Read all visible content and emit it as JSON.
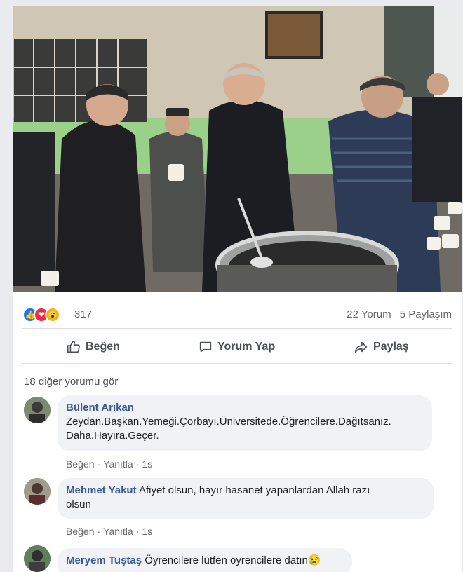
{
  "post": {
    "photo_alt_icon": "photo",
    "reactions": {
      "icons": [
        "like-icon",
        "love-icon",
        "wow-icon"
      ],
      "count": "317"
    },
    "stats": {
      "comments": "22 Yorum",
      "shares": "5 Paylaşım"
    },
    "actions": {
      "like": "Beğen",
      "comment": "Yorum Yap",
      "share": "Paylaş"
    }
  },
  "comments_section": {
    "see_more": "18 diğer yorumu gör",
    "items": [
      {
        "author": "Bülent Arıkan",
        "text": "Zeydan.Başkan.Yemeği.Çorbayı.Üniversitede.Öğrencilere.Dağıtsanız.",
        "text2": "Daha.Hayıra.Geçer.",
        "like": "Beğen",
        "reply": "Yanıtla",
        "time": "1s"
      },
      {
        "author": "Mehmet Yakut",
        "text": "Afiyet olsun, hayır hasanet yapanlardan Allah razı",
        "text2": "olsun",
        "like": "Beğen",
        "reply": "Yanıtla",
        "time": "1s"
      },
      {
        "author": "Meryem Tuştaş",
        "text": "Öyrencilere lütfen öyrencilere datın😢"
      }
    ]
  },
  "colors": {
    "link_blue": "#385898",
    "like_blue": "#1877f2",
    "love_red": "#f0284a",
    "wow_yellow": "#f7b125"
  }
}
